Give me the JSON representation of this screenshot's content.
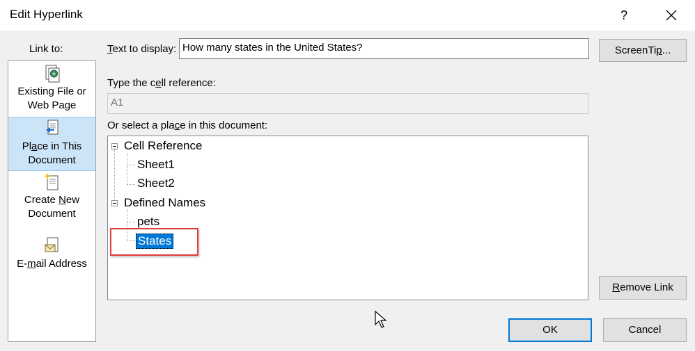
{
  "window": {
    "title": "Edit Hyperlink",
    "help": "?",
    "close": "close-icon"
  },
  "sidebar": {
    "label": "Link to:",
    "items": [
      {
        "line1": "Existing File or",
        "line2": "Web Page",
        "icon": "file-web-icon",
        "selected": false
      },
      {
        "line1": "Place in This",
        "line2": "Document",
        "icon": "place-in-document-icon",
        "selected": true
      },
      {
        "line1": "Create New",
        "line2": "Document",
        "icon": "new-document-icon",
        "selected": false
      },
      {
        "line1": "E-mail Address",
        "line2": "",
        "icon": "email-icon",
        "selected": false
      }
    ]
  },
  "main": {
    "text_to_display_label": "Text to display:",
    "text_to_display_value": "How many states in the United States?",
    "screentip_button": "ScreenTip...",
    "cell_ref_label": "Type the cell reference:",
    "cell_ref_value": "A1",
    "select_place_label": "Or select a place in this document:",
    "tree": {
      "groups": [
        {
          "label": "Cell Reference",
          "children": [
            "Sheet1",
            "Sheet2"
          ]
        },
        {
          "label": "Defined Names",
          "children": [
            "pets",
            "States"
          ]
        }
      ],
      "selected": "States"
    },
    "remove_link_button": "Remove Link",
    "ok_button": "OK",
    "cancel_button": "Cancel"
  },
  "colors": {
    "selection": "#0078d7",
    "sidebar_selected": "#cce4f7",
    "highlight_box": "#e23b3b"
  }
}
